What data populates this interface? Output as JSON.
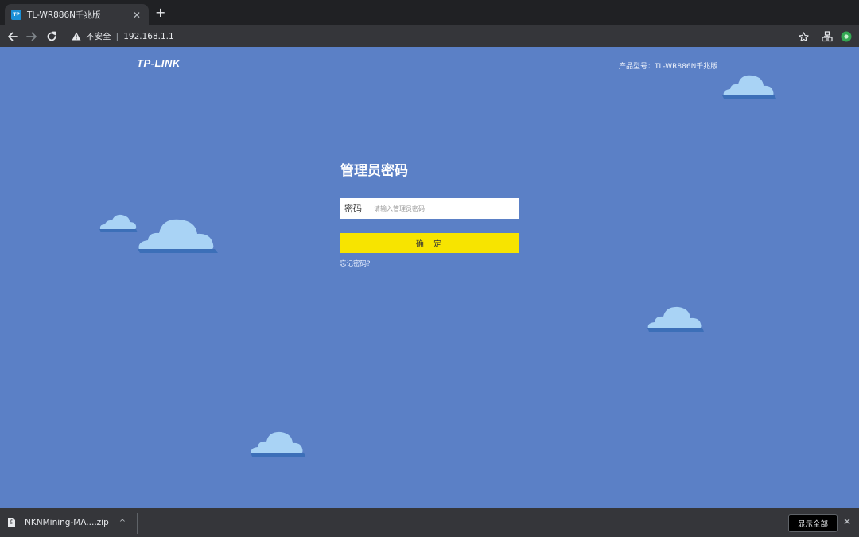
{
  "browser": {
    "tab": {
      "favicon_text": "TP",
      "title": "TL-WR886N千兆版",
      "close": "✕"
    },
    "new_tab": "+",
    "address": {
      "insecure_label": "不安全",
      "separator": "|",
      "url": "192.168.1.1"
    }
  },
  "page": {
    "logo": "TP-LINK",
    "model": "产品型号：TL-WR886N千兆版",
    "login": {
      "title": "管理员密码",
      "password_label": "密码",
      "password_placeholder": "请输入管理员密码",
      "password_value": "",
      "submit_label": "确  定",
      "forgot_link": "忘记密码?"
    }
  },
  "download_shelf": {
    "file_name": "NKNMining-MA....zip",
    "caret": "^",
    "show_all": "显示全部",
    "close": "✕"
  },
  "colors": {
    "page_background": "#5b80c6",
    "submit_button": "#f7e400",
    "cloud": "#a9d3f5",
    "chrome_dark": "#202124",
    "chrome_toolbar": "#35363a"
  },
  "icons": {
    "back": "back-arrow-icon",
    "forward": "forward-arrow-icon",
    "reload": "reload-icon",
    "warning": "warning-icon",
    "star": "bookmark-star-icon",
    "extension": "extension-icon",
    "profile": "profile-icon",
    "file": "file-icon"
  }
}
